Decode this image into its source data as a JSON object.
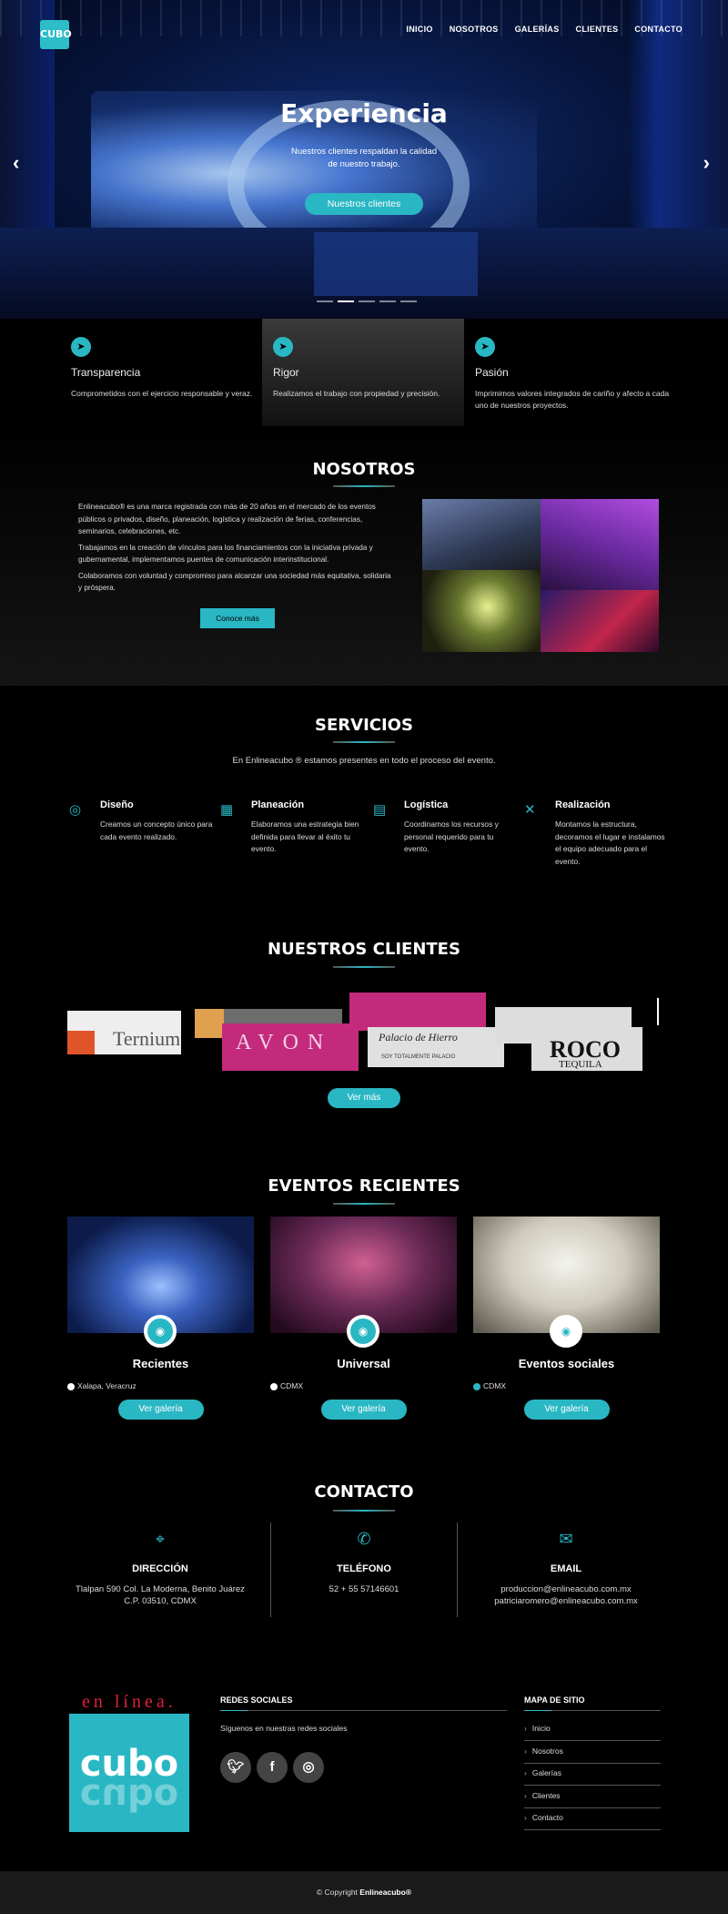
{
  "nav": {
    "logo": "CUBO",
    "items": [
      "INICIO",
      "NOSOTROS",
      "GALERÍAS",
      "CLIENTES",
      "CONTACTO"
    ]
  },
  "hero": {
    "title": "Experiencia",
    "text": "Nuestros clientes respaldan la calidad de nuestro trabajo.",
    "button": "Nuestros clientes"
  },
  "features": [
    {
      "title": "Transparencia",
      "text": "Comprometidos con el ejercicio responsable y veraz."
    },
    {
      "title": "Rigor",
      "text": "Realizamos el trabajo con propiedad y precisión."
    },
    {
      "title": "Pasión",
      "text": "Imprimimos valores integrados de cariño y afecto a cada uno de nuestros proyectos."
    }
  ],
  "nosotros": {
    "title": "NOSOTROS",
    "p1": "Enlineacubo® es una marca registrada con más de 20 años en el mercado de los eventos públicos o privados, diseño, planeación, logística y realización de ferias, conferencias, seminarios, celebraciones, etc.",
    "p2": "Trabajamos en la creación de vínculos para los financiamientos con la iniciativa privada y gubernamental, implementamos puentes de comunicación interinstitucional.",
    "p3": "Colaboramos con voluntad y compromiso para alcanzar una sociedad más equitativa, solidaria y próspera.",
    "button": "Conoce más"
  },
  "servicios": {
    "title": "SERVICIOS",
    "intro": "En Enlineacubo ® estamos presentes en todo el proceso del evento.",
    "items": [
      {
        "title": "Diseño",
        "text": "Creamos un concepto único para cada evento realizado."
      },
      {
        "title": "Planeación",
        "text": "Elaboramos una estrategia bien definida para llevar al éxito tu evento."
      },
      {
        "title": "Logística",
        "text": "Coordinamos los recursos y personal requerido para tu evento."
      },
      {
        "title": "Realización",
        "text": "Montamos la estructura, decoramos el lugar e instalamos el equipo adecuado para el evento."
      }
    ]
  },
  "clientes": {
    "title": "NUESTROS CLIENTES",
    "logos": {
      "ternium": "Ternium",
      "avon": "AVON",
      "palacio": "Palacio de Hierro",
      "palacio_sub": "SOY TOTALMENTE PALACIO",
      "tequila": "ROCO",
      "tequila_sub": "TEQUILA"
    },
    "button": "Ver más"
  },
  "eventos": {
    "title": "EVENTOS RECIENTES",
    "items": [
      {
        "title": "Recientes",
        "location": "Xalapa, Veracruz",
        "button": "Ver galería"
      },
      {
        "title": "Universal",
        "location": "CDMX",
        "button": "Ver galería"
      },
      {
        "title": "Eventos sociales",
        "location": "CDMX",
        "button": "Ver galería"
      }
    ]
  },
  "contacto": {
    "title": "CONTACTO",
    "direccion": {
      "label": "DIRECCIÓN",
      "line1": "Tlalpan 590 Col. La Moderna, Benito Juárez",
      "line2": "C.P. 03510, CDMX"
    },
    "telefono": {
      "label": "TELÉFONO",
      "value": "52 + 55 57146601"
    },
    "email": {
      "label": "EMAIL",
      "line1": "produccion@enlineacubo.com.mx",
      "line2": "patriciaromero@enlineacubo.com.mx"
    }
  },
  "footer": {
    "brand_top": "en línea.",
    "brand": "cubo",
    "redes_title": "REDES SOCIALES",
    "redes_text": "Síguenos en nuestras redes sociales",
    "mapa_title": "MAPA DE SITIO",
    "mapa_items": [
      "Inicio",
      "Nosotros",
      "Galerías",
      "Clientes",
      "Contacto"
    ],
    "copyright_prefix": "© Copyright ",
    "copyright_brand": "Enlineacubo®"
  },
  "colors": {
    "accent": "#2ab7c4",
    "background": "#000000",
    "brand_red": "#e0203a"
  }
}
